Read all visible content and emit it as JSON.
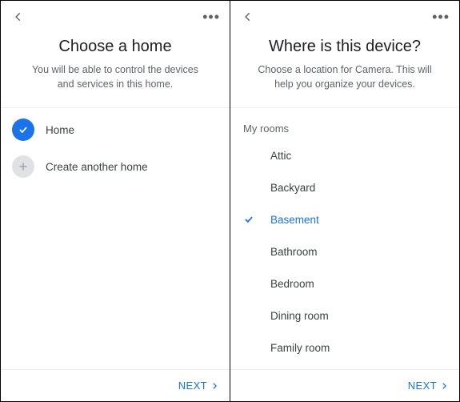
{
  "left": {
    "title": "Choose a home",
    "subtitle": "You will be able to control the devices and services in this home.",
    "options": [
      {
        "icon": "check-circle-icon",
        "label": "Home",
        "selected": true
      },
      {
        "icon": "plus-circle-icon",
        "label": "Create another home",
        "selected": false
      }
    ],
    "next_label": "NEXT"
  },
  "right": {
    "title": "Where is this device?",
    "subtitle": "Choose a location for Camera. This will help you organize your devices.",
    "section_label": "My rooms",
    "rooms": [
      {
        "name": "Attic",
        "selected": false
      },
      {
        "name": "Backyard",
        "selected": false
      },
      {
        "name": "Basement",
        "selected": true
      },
      {
        "name": "Bathroom",
        "selected": false
      },
      {
        "name": "Bedroom",
        "selected": false
      },
      {
        "name": "Dining room",
        "selected": false
      },
      {
        "name": "Family room",
        "selected": false
      }
    ],
    "next_label": "NEXT"
  }
}
